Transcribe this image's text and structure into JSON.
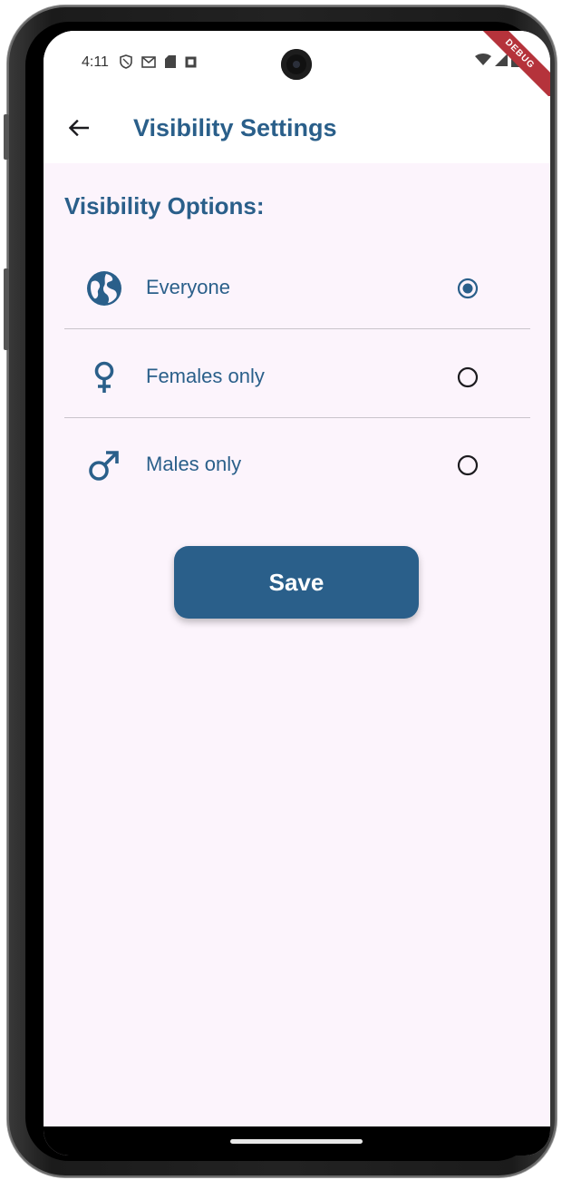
{
  "status_bar": {
    "time": "4:11",
    "icons_left": [
      "shield-icon",
      "gmail-icon",
      "sd-card-icon",
      "notification-icon"
    ],
    "icons_right": [
      "wifi-icon",
      "signal-icon",
      "battery-icon"
    ],
    "debug_banner": "DEBUG"
  },
  "app_bar": {
    "title": "Visibility Settings",
    "back_icon": "arrow-back-icon"
  },
  "content": {
    "section_title": "Visibility Options:",
    "options": [
      {
        "label": "Everyone",
        "icon": "globe-icon",
        "selected": true
      },
      {
        "label": "Females only",
        "icon": "female-icon",
        "selected": false
      },
      {
        "label": "Males only",
        "icon": "male-icon",
        "selected": false
      }
    ],
    "save_label": "Save"
  },
  "colors": {
    "primary": "#2a5f8a",
    "background": "#fcf4fc",
    "divider": "#c9c4cb",
    "debug_ribbon": "#b5333b"
  }
}
